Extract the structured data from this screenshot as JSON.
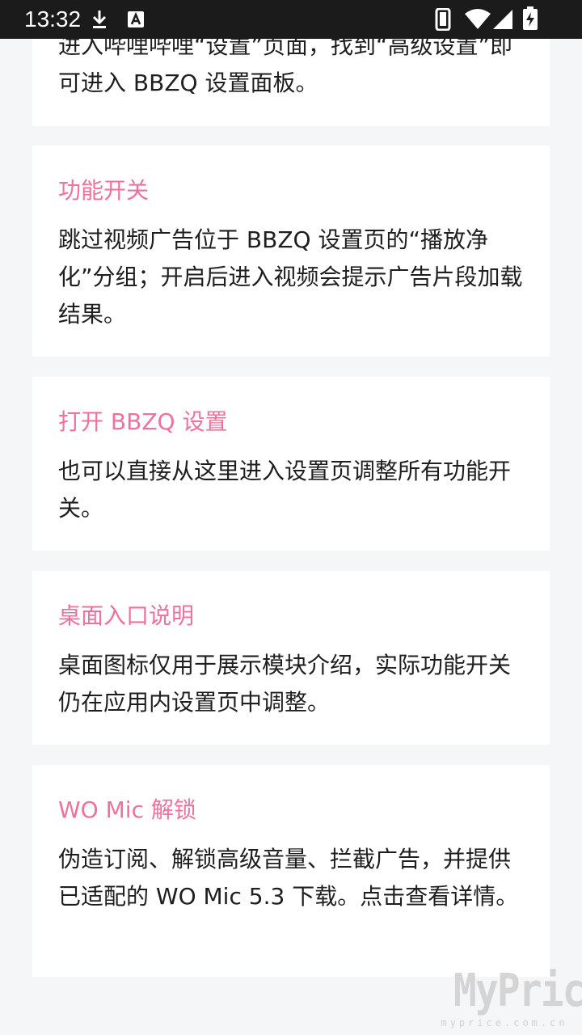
{
  "status_bar": {
    "time": "13:32"
  },
  "cards": [
    {
      "title": "",
      "body": "进入哔哩哔哩“设置”页面，找到“高级设置”即可进入 BBZQ 设置面板。"
    },
    {
      "title": "功能开关",
      "body": "跳过视频广告位于 BBZQ 设置页的“播放净化”分组；开启后进入视频会提示广告片段加载结果。"
    },
    {
      "title": "打开 BBZQ 设置",
      "body": "也可以直接从这里进入设置页调整所有功能开关。"
    },
    {
      "title": "桌面入口说明",
      "body": "桌面图标仅用于展示模块介绍，实际功能开关仍在应用内设置页中调整。"
    },
    {
      "title": "WO Mic 解锁",
      "body": "伪造订阅、解锁高级音量、拦截广告，并提供已适配的 WO Mic 5.3 下载。点击查看详情。"
    }
  ],
  "watermark": {
    "main": "MyPrice",
    "sub": "myprice.com.cn"
  },
  "colors": {
    "accent": "#f0719a",
    "background": "#f5f6f8",
    "card": "#ffffff",
    "status_bar": "#1b1b1b"
  },
  "icons": [
    "download-icon",
    "notification-a-icon",
    "phone-icon",
    "wifi-icon",
    "signal-icon",
    "battery-charging-icon"
  ]
}
